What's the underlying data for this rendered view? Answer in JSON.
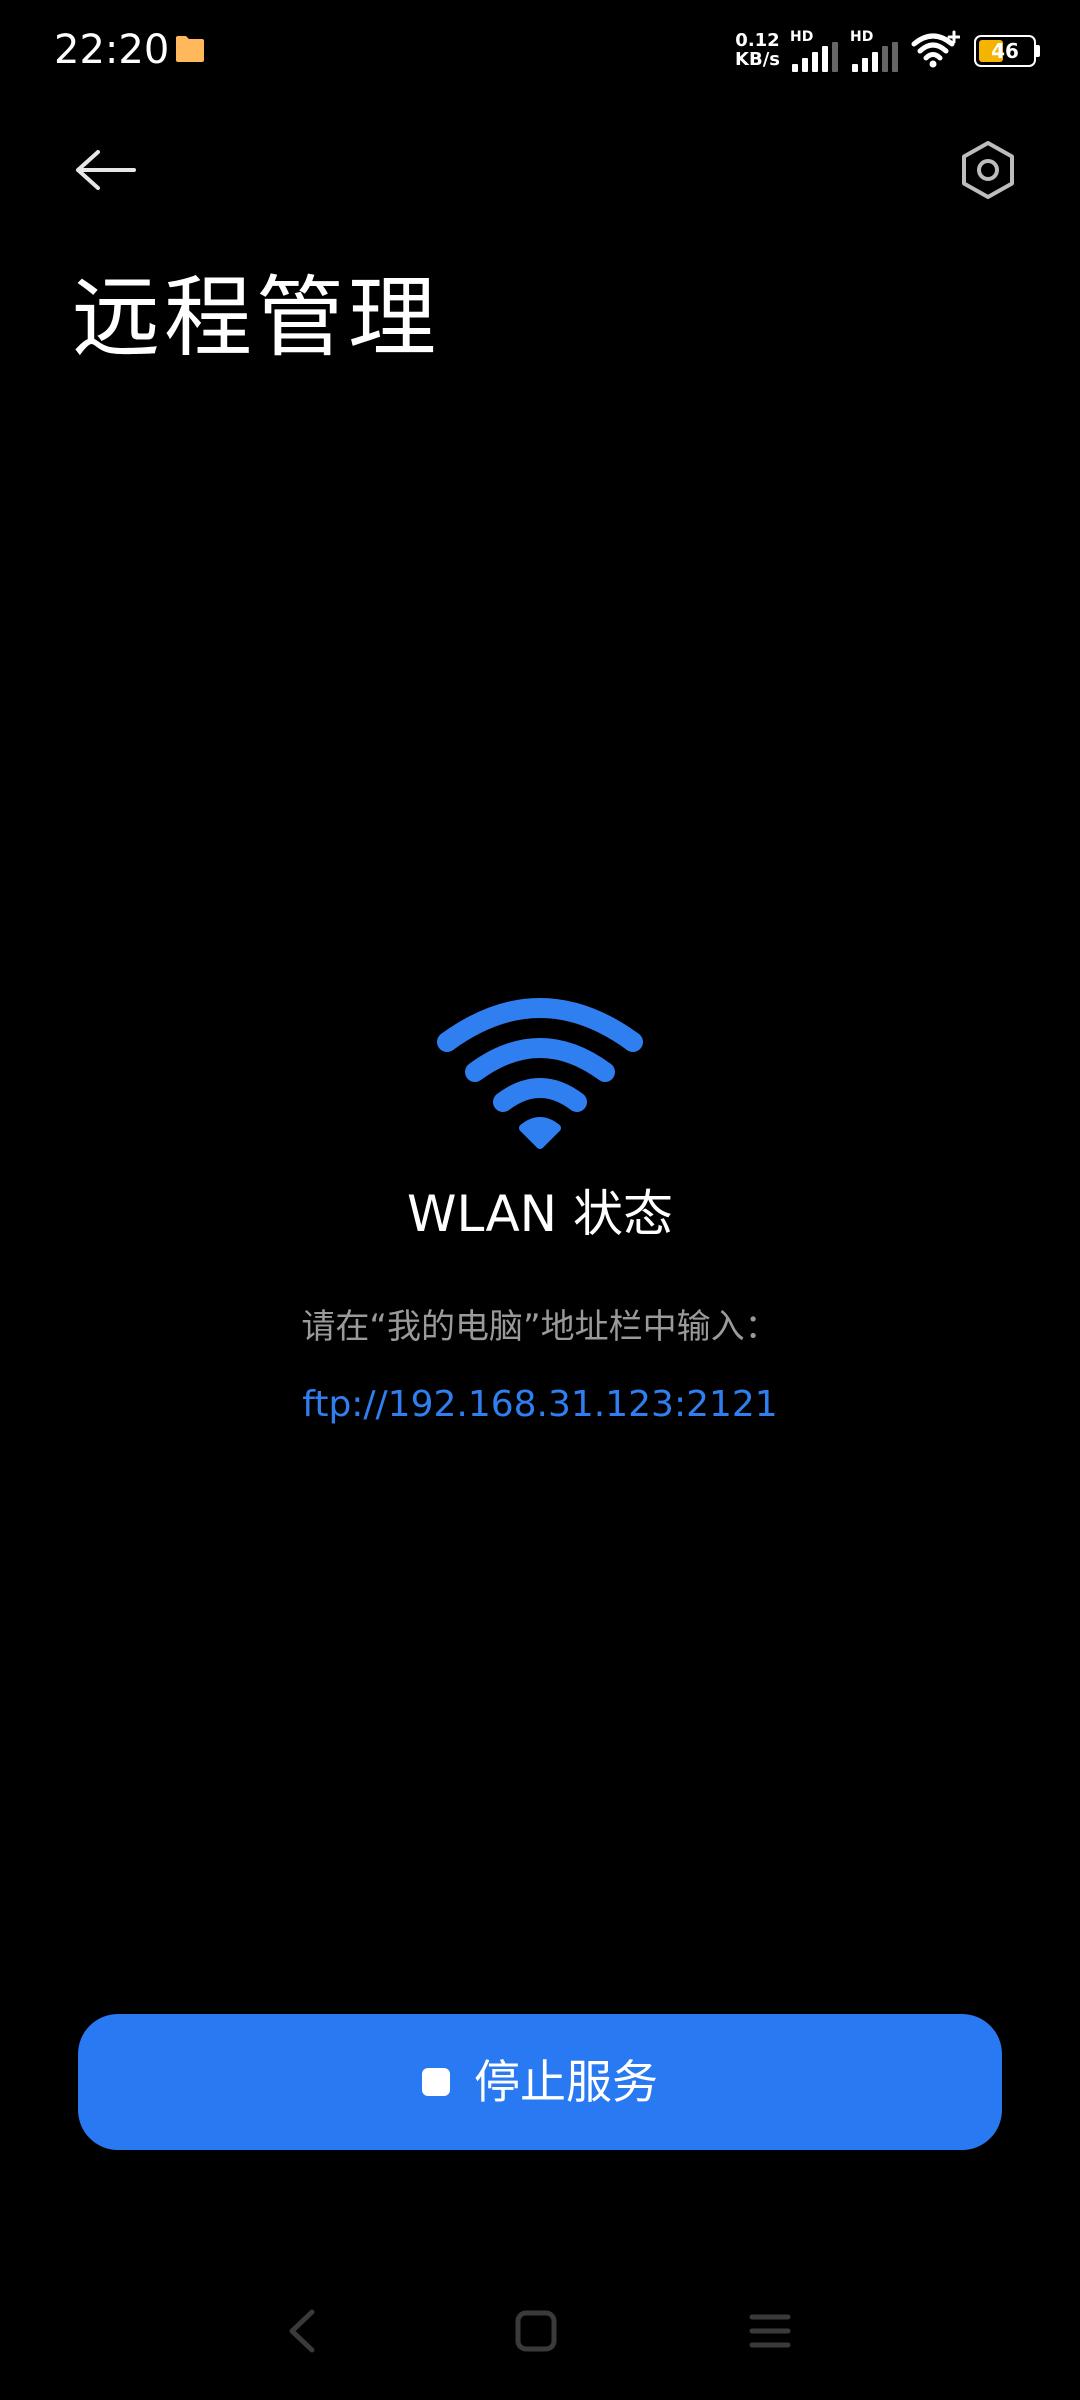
{
  "status_bar": {
    "time": "22:20",
    "net_speed_value": "0.12",
    "net_speed_unit": "KB/s",
    "signal1_label": "HD",
    "signal2_label": "HD",
    "battery_level": "46",
    "battery_fraction": 0.46,
    "folder_icon": "folder-icon",
    "folder_color": "#ffb85c",
    "battery_color": "#f5b400"
  },
  "header": {
    "back_icon": "arrow-left-icon",
    "settings_icon": "hexagon-settings-icon",
    "title": "远程管理"
  },
  "main": {
    "wifi_icon": "wifi-icon",
    "wifi_color": "#2f7ff0",
    "status_label": "WLAN 状态",
    "instruction": "请在“我的电脑”地址栏中输入：",
    "ftp_address": "ftp://192.168.31.123:2121"
  },
  "actions": {
    "stop_label": "停止服务",
    "stop_icon": "stop-square-icon",
    "button_color": "#2979f2"
  },
  "nav_bar": {
    "back_icon": "nav-back-icon",
    "home_icon": "nav-home-icon",
    "menu_icon": "nav-menu-icon"
  }
}
